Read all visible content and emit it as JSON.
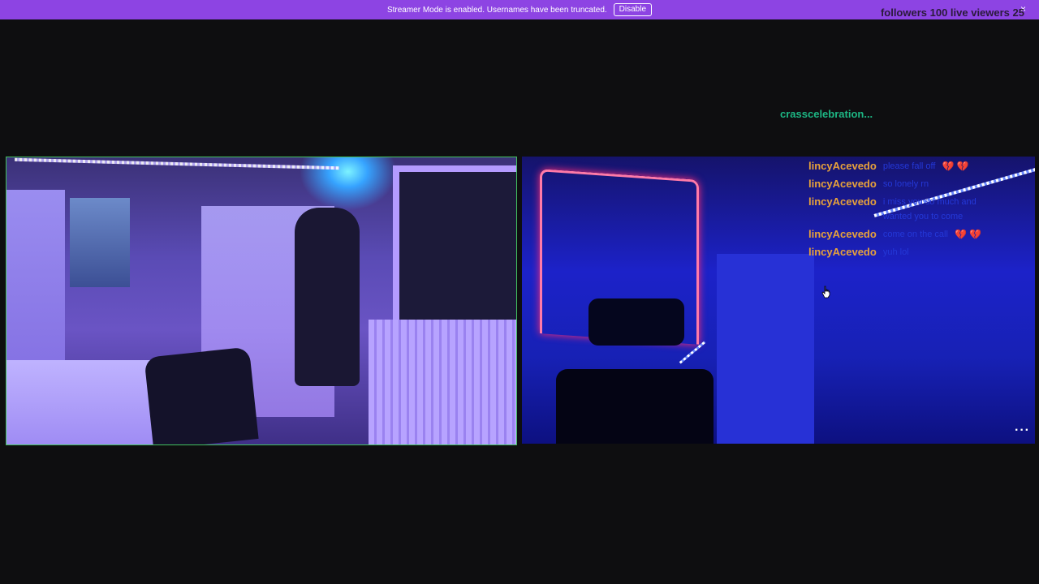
{
  "banner": {
    "message": "Streamer Mode is enabled. Usernames have been truncated.",
    "disable_label": "Disable",
    "close_glyph": "×",
    "color": "#8d44e3"
  },
  "stats": {
    "text": "followers 100 live viewers 25"
  },
  "top_username": "crasscelebration...",
  "chat": {
    "messages": [
      {
        "user": "lincyAcevedo",
        "text": "please fall off",
        "hearts": "💔 💔"
      },
      {
        "user": "lincyAcevedo",
        "text": "so lonely rn",
        "hearts": ""
      },
      {
        "user": "lincyAcevedo",
        "text": "i miss you so much and wanted you to come",
        "hearts": ""
      },
      {
        "user": "lincyAcevedo",
        "text": "come on the call",
        "hearts": "💔 💔"
      },
      {
        "user": "lincyAcevedo",
        "text": "yuh lol",
        "hearts": ""
      }
    ],
    "username_color": "#e8a23a"
  },
  "feeds": {
    "left_border_color": "#43c25f"
  },
  "controls": {
    "more_glyph": "···"
  },
  "icons": {
    "cursor": "hand-pointer-icon",
    "more": "more-options-icon",
    "close": "close-icon"
  }
}
